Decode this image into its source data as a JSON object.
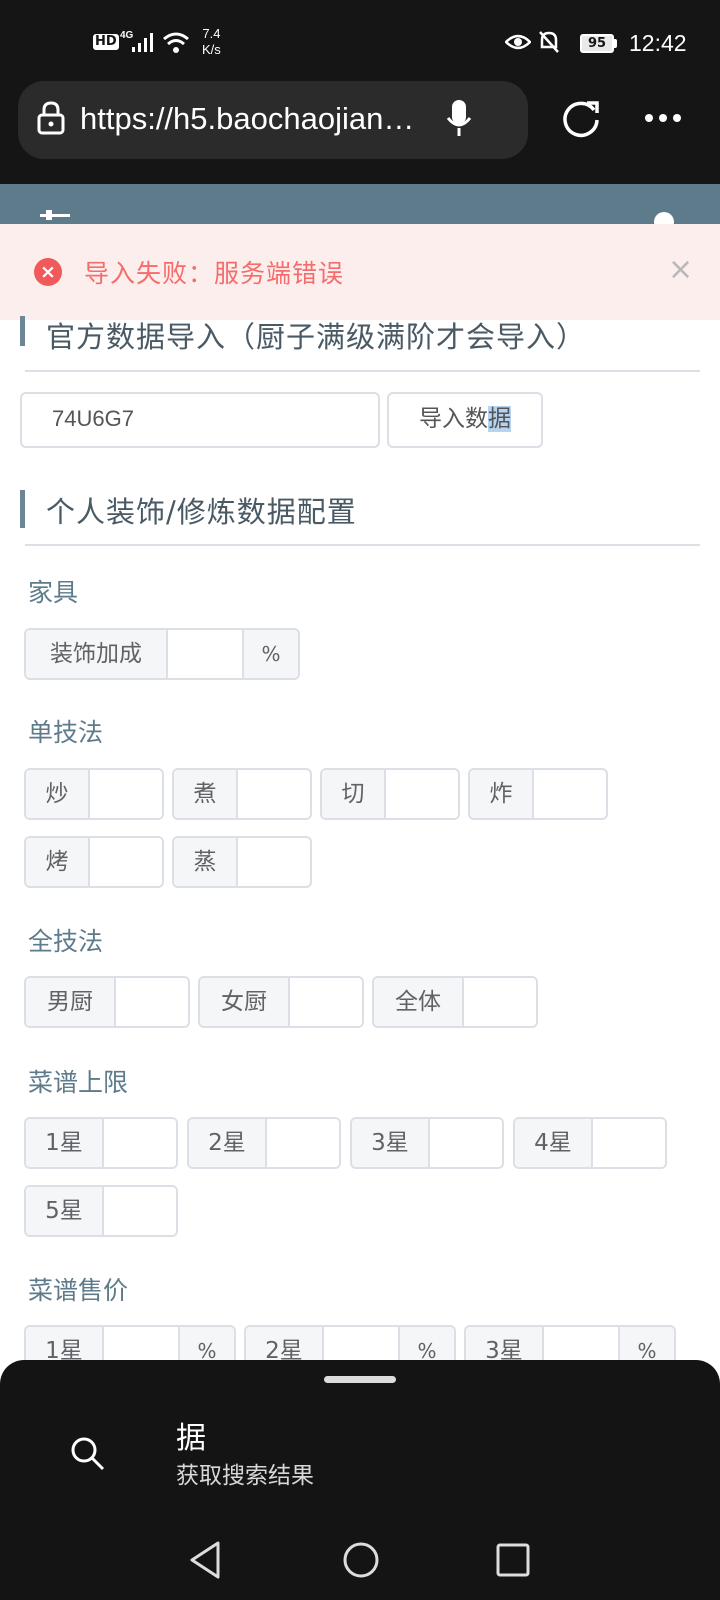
{
  "status_bar": {
    "hd": "HD",
    "network": "4G",
    "speed_value": "7.4",
    "speed_unit": "K/s",
    "battery": "95",
    "time": "12:42"
  },
  "browser": {
    "url": "https://h5.baochaojianghu.com"
  },
  "toast": {
    "message": "导入失败：服务端错误"
  },
  "official_import": {
    "title": "官方数据导入（厨子满级满阶才会导入）",
    "code_value": "74U6G7",
    "button_prefix": "导入数",
    "button_highlight": "据"
  },
  "personal": {
    "title": "个人装饰/修炼数据配置",
    "furniture": {
      "label": "家具",
      "item_label": "装饰加成",
      "suffix": "%"
    },
    "single_skill": {
      "label": "单技法",
      "items": [
        "炒",
        "煮",
        "切",
        "炸",
        "烤",
        "蒸"
      ]
    },
    "all_skill": {
      "label": "全技法",
      "items": [
        "男厨",
        "女厨",
        "全体"
      ]
    },
    "recipe_limit": {
      "label": "菜谱上限",
      "items": [
        "1星",
        "2星",
        "3星",
        "4星",
        "5星"
      ]
    },
    "recipe_price": {
      "label": "菜谱售价",
      "items": [
        "1星",
        "2星",
        "3星"
      ],
      "suffix": "%"
    }
  },
  "search_sheet": {
    "query": "据",
    "subtitle": "获取搜索结果"
  },
  "colors": {
    "accent": "#5d7b8b",
    "error": "#f56c6c",
    "border": "#dcdfe6"
  }
}
